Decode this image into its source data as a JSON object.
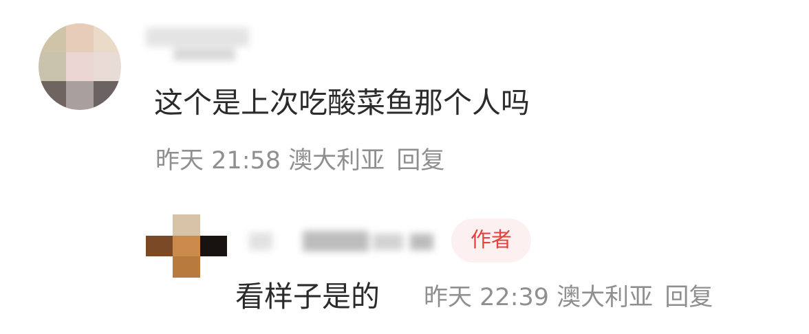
{
  "comment": {
    "text": "这个是上次吃酸菜鱼那个人吗",
    "date": "昨天",
    "time": "21:58",
    "location": "澳大利亚",
    "reply_label": "回复"
  },
  "reply": {
    "author_badge": "作者",
    "text": "看样子是的",
    "date": "昨天",
    "time": "22:39",
    "location": "澳大利亚",
    "reply_label": "回复"
  },
  "colors": {
    "primary_text": "#2b2b2b",
    "meta_text": "#8f8f8f",
    "badge_text": "#e0443f",
    "badge_bg": "#fdf0f0"
  },
  "icons": {
    "commenter_avatar": "pixelated-avatar",
    "author_avatar": "pixelated-avatar"
  }
}
